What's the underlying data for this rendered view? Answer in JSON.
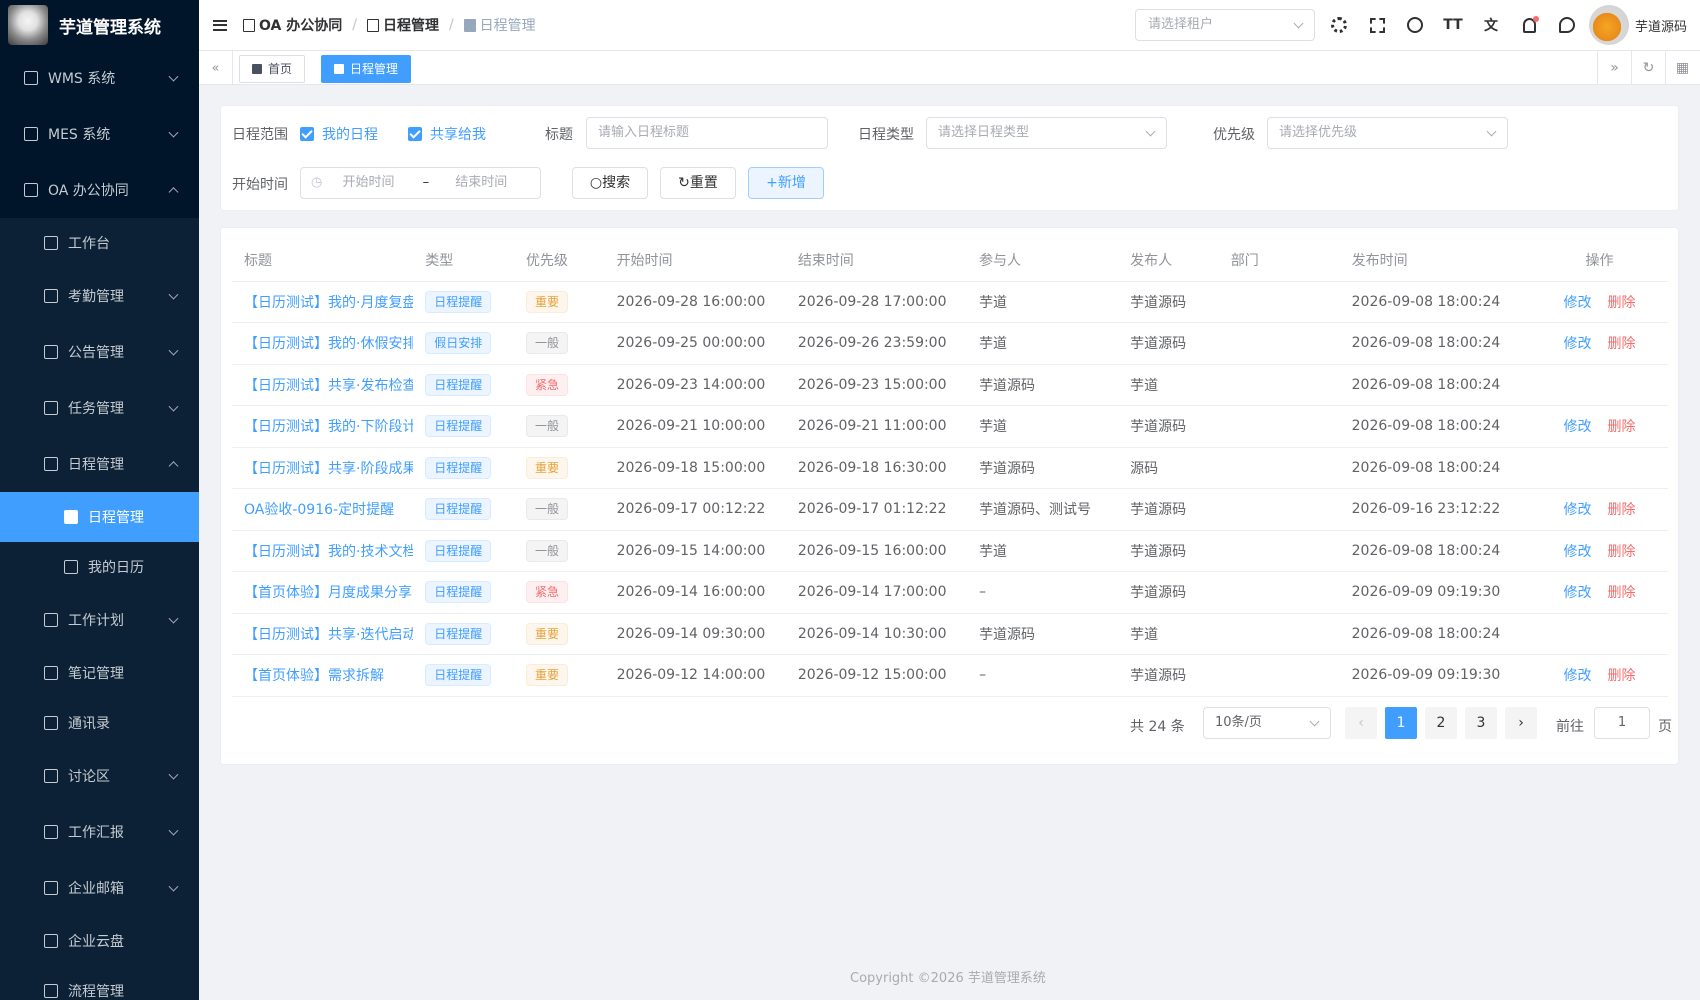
{
  "app": {
    "title": "芋道管理系统",
    "user_name": "芋道源码",
    "tenant_placeholder": "请选择租户"
  },
  "sidebar": {
    "items": [
      {
        "label": "WMS 系统",
        "icon": "box-icon",
        "expanded": false
      },
      {
        "label": "MES 系统",
        "icon": "chip-icon",
        "expanded": false
      },
      {
        "label": "OA 办公协同",
        "icon": "building-icon",
        "expanded": true
      },
      {
        "label": "工作台",
        "icon": "home-icon"
      },
      {
        "label": "考勤管理",
        "icon": "calendar-icon",
        "expanded": false
      },
      {
        "label": "公告管理",
        "icon": "bell-icon",
        "expanded": false
      },
      {
        "label": "任务管理",
        "icon": "clipboard-icon",
        "expanded": false
      },
      {
        "label": "日程管理",
        "icon": "calendar-icon",
        "expanded": true
      },
      {
        "label": "日程管理",
        "icon": "doc-icon",
        "active": true
      },
      {
        "label": "我的日历",
        "icon": "calendar-icon"
      },
      {
        "label": "工作计划",
        "icon": "calendar-icon",
        "expanded": false
      },
      {
        "label": "笔记管理",
        "icon": "notebook-icon"
      },
      {
        "label": "通讯录",
        "icon": "phone-icon"
      },
      {
        "label": "讨论区",
        "icon": "chat-icon",
        "expanded": false
      },
      {
        "label": "工作汇报",
        "icon": "report-icon",
        "expanded": false
      },
      {
        "label": "企业邮箱",
        "icon": "mail-icon",
        "expanded": false
      },
      {
        "label": "企业云盘",
        "icon": "folder-icon"
      },
      {
        "label": "流程管理",
        "icon": "flow-icon"
      }
    ]
  },
  "breadcrumb": [
    "OA 办公协同",
    "日程管理",
    "日程管理"
  ],
  "tags": [
    {
      "label": "首页",
      "icon": "home-icon"
    },
    {
      "label": "日程管理",
      "icon": "doc-icon",
      "active": true
    }
  ],
  "search": {
    "range_label": "日程范围",
    "my_schedule": "我的日程",
    "shared_to_me": "共享给我",
    "title_label": "标题",
    "title_placeholder": "请输入日程标题",
    "type_label": "日程类型",
    "type_placeholder": "请选择日程类型",
    "priority_label": "优先级",
    "priority_placeholder": "请选择优先级",
    "start_label": "开始时间",
    "start_placeholder": "开始时间",
    "range_sep": "–",
    "end_placeholder": "结束时间",
    "search_btn": "搜索",
    "reset_btn": "重置",
    "add_btn": "+新增"
  },
  "table": {
    "columns": [
      "标题",
      "类型",
      "优先级",
      "开始时间",
      "结束时间",
      "参与人",
      "发布人",
      "部门",
      "发布时间",
      "操作"
    ],
    "edit_label": "修改",
    "delete_label": "删除",
    "rows": [
      {
        "title": "【日历测试】我的·月度复盘",
        "type": "日程提醒",
        "priority": "重要",
        "start": "2026-09-28 16:00:00",
        "end": "2026-09-28 17:00:00",
        "participants": "芋道",
        "publisher": "芋道源码",
        "dept": "",
        "published": "2026-09-08 18:00:24",
        "ops": true
      },
      {
        "title": "【日历测试】我的·休假安排",
        "type": "假日安排",
        "priority": "一般",
        "start": "2026-09-25 00:00:00",
        "end": "2026-09-26 23:59:00",
        "participants": "芋道",
        "publisher": "芋道源码",
        "dept": "",
        "published": "2026-09-08 18:00:24",
        "ops": true
      },
      {
        "title": "【日历测试】共享·发布检查",
        "type": "日程提醒",
        "priority": "紧急",
        "start": "2026-09-23 14:00:00",
        "end": "2026-09-23 15:00:00",
        "participants": "芋道源码",
        "publisher": "芋道",
        "dept": "",
        "published": "2026-09-08 18:00:24",
        "ops": false
      },
      {
        "title": "【日历测试】我的·下阶段计划",
        "type": "日程提醒",
        "priority": "一般",
        "start": "2026-09-21 10:00:00",
        "end": "2026-09-21 11:00:00",
        "participants": "芋道",
        "publisher": "芋道源码",
        "dept": "",
        "published": "2026-09-08 18:00:24",
        "ops": true
      },
      {
        "title": "【日历测试】共享·阶段成果",
        "type": "日程提醒",
        "priority": "重要",
        "start": "2026-09-18 15:00:00",
        "end": "2026-09-18 16:30:00",
        "participants": "芋道源码",
        "publisher": "源码",
        "dept": "",
        "published": "2026-09-08 18:00:24",
        "ops": false
      },
      {
        "title": "OA验收-0916-定时提醒",
        "type": "日程提醒",
        "priority": "一般",
        "start": "2026-09-17 00:12:22",
        "end": "2026-09-17 01:12:22",
        "participants": "芋道源码、测试号",
        "publisher": "芋道源码",
        "dept": "",
        "published": "2026-09-16 23:12:22",
        "ops": true
      },
      {
        "title": "【日历测试】我的·技术文档",
        "type": "日程提醒",
        "priority": "一般",
        "start": "2026-09-15 14:00:00",
        "end": "2026-09-15 16:00:00",
        "participants": "芋道",
        "publisher": "芋道源码",
        "dept": "",
        "published": "2026-09-08 18:00:24",
        "ops": true
      },
      {
        "title": "【首页体验】月度成果分享",
        "type": "日程提醒",
        "priority": "紧急",
        "start": "2026-09-14 16:00:00",
        "end": "2026-09-14 17:00:00",
        "participants": "–",
        "publisher": "芋道源码",
        "dept": "",
        "published": "2026-09-09 09:19:30",
        "ops": true
      },
      {
        "title": "【日历测试】共享·迭代启动",
        "type": "日程提醒",
        "priority": "重要",
        "start": "2026-09-14 09:30:00",
        "end": "2026-09-14 10:30:00",
        "participants": "芋道源码",
        "publisher": "芋道",
        "dept": "",
        "published": "2026-09-08 18:00:24",
        "ops": false
      },
      {
        "title": "【首页体验】需求拆解",
        "type": "日程提醒",
        "priority": "重要",
        "start": "2026-09-12 14:00:00",
        "end": "2026-09-12 15:00:00",
        "participants": "–",
        "publisher": "芋道源码",
        "dept": "",
        "published": "2026-09-09 09:19:30",
        "ops": true
      }
    ]
  },
  "pagination": {
    "total_text": "共 24 条",
    "page_size": "10条/页",
    "pages": [
      "1",
      "2",
      "3"
    ],
    "current": "1",
    "goto_label": "前往",
    "goto_value": "1",
    "page_suffix": "页"
  },
  "footer": {
    "copyright": "Copyright ©2026 芋道管理系统"
  },
  "colors": {
    "primary": "#409eff",
    "sidebar_bg": "#001529",
    "danger": "#f56c6c",
    "warning": "#e6a23c"
  }
}
